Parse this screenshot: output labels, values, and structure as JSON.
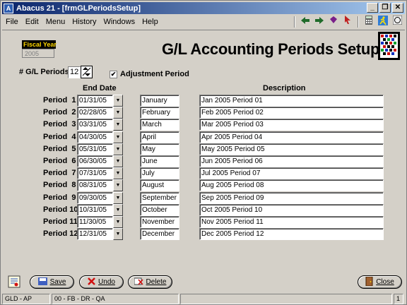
{
  "window": {
    "title": "Abacus 21 - [frmGLPeriodsSetup]",
    "controls": {
      "minimize": "_",
      "restore": "❐",
      "close": "✕"
    }
  },
  "menu": [
    "File",
    "Edit",
    "Menu",
    "History",
    "Windows",
    "Help"
  ],
  "toolbar_icons": [
    "arrow-left-icon",
    "arrow-right-icon",
    "gem-icon",
    "pointer-icon",
    "calculator-icon",
    "run-icon",
    "help-icon"
  ],
  "fiscal_year": {
    "label": "Fiscal Year",
    "value": "2005"
  },
  "page_title": "G/L Accounting Periods Setup",
  "num_periods": {
    "label": "# G/L Periods",
    "value": "12"
  },
  "adjustment_period": {
    "label": "Adjustment Period",
    "checked": true
  },
  "columns": {
    "end_date": "End Date",
    "description": "Description"
  },
  "periods": [
    {
      "label": "Period  1",
      "end_date": "01/31/05",
      "month": "January",
      "description": "Jan 2005 Period 01"
    },
    {
      "label": "Period  2",
      "end_date": "02/28/05",
      "month": "February",
      "description": "Feb 2005 Period 02"
    },
    {
      "label": "Period  3",
      "end_date": "03/31/05",
      "month": "March",
      "description": "Mar 2005 Period 03"
    },
    {
      "label": "Period  4",
      "end_date": "04/30/05",
      "month": "April",
      "description": "Apr 2005 Period 04"
    },
    {
      "label": "Period  5",
      "end_date": "05/31/05",
      "month": "May",
      "description": "May 2005 Period 05"
    },
    {
      "label": "Period  6",
      "end_date": "06/30/05",
      "month": "June",
      "description": "Jun 2005 Period 06"
    },
    {
      "label": "Period  7",
      "end_date": "07/31/05",
      "month": "July",
      "description": "Jul 2005 Period 07"
    },
    {
      "label": "Period  8",
      "end_date": "08/31/05",
      "month": "August",
      "description": "Aug 2005 Period 08"
    },
    {
      "label": "Period  9",
      "end_date": "09/30/05",
      "month": "September",
      "description": "Sep 2005 Period 09"
    },
    {
      "label": "Period 10",
      "end_date": "10/31/05",
      "month": "October",
      "description": "Oct 2005 Period 10"
    },
    {
      "label": "Period 11",
      "end_date": "11/30/05",
      "month": "November",
      "description": "Nov 2005 Period 11"
    },
    {
      "label": "Period 12",
      "end_date": "12/31/05",
      "month": "December",
      "description": "Dec 2005 Period 12"
    }
  ],
  "buttons": {
    "save": "Save",
    "undo": "Undo",
    "delete": "Delete",
    "close": "Close"
  },
  "status": [
    "GLD - AP",
    "00 - FB - DR - QA",
    "",
    "1"
  ]
}
